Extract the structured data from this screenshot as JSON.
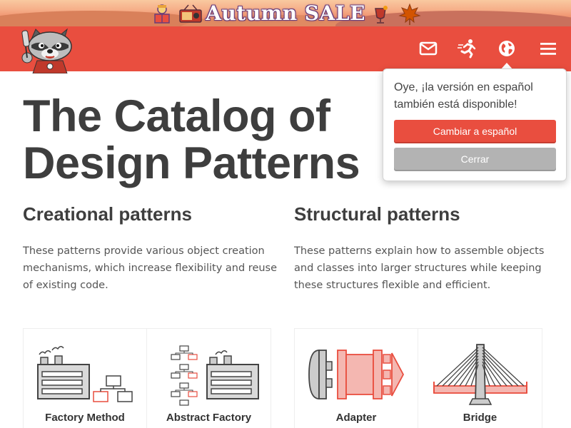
{
  "promo": {
    "text": "Autumn SALE",
    "icons": [
      "reading-book-icon",
      "radio-icon",
      "mulled-wine-icon",
      "maple-leaf-icon"
    ]
  },
  "header": {
    "brand_color": "#e94e3f",
    "logo": "raccoon-mascot-logo",
    "nav_icons": [
      "mail-icon",
      "running-man-icon",
      "globe-icon",
      "hamburger-menu-icon"
    ]
  },
  "main": {
    "title": "The Catalog of Design Patterns",
    "sections": [
      {
        "heading": "Creational patterns",
        "description": "These patterns provide various object creation mechanisms, which increase flexibility and reuse of existing code.",
        "cards": [
          {
            "label": "Factory Method",
            "icon": "factory-method-icon"
          },
          {
            "label": "Abstract Factory",
            "icon": "abstract-factory-icon"
          }
        ]
      },
      {
        "heading": "Structural patterns",
        "description": "These patterns explain how to assemble objects and classes into larger structures while keeping these structures flexible and efficient.",
        "cards": [
          {
            "label": "Adapter",
            "icon": "adapter-icon"
          },
          {
            "label": "Bridge",
            "icon": "bridge-icon"
          }
        ]
      }
    ]
  },
  "language_popover": {
    "message": "Oye, ¡la versión en español también está disponible!",
    "primary_button": "Cambiar a español",
    "secondary_button": "Cerrar"
  }
}
